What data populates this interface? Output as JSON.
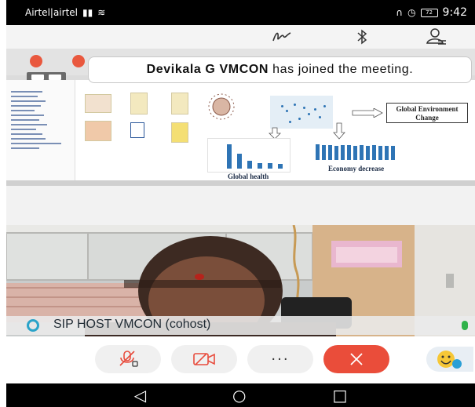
{
  "status_bar": {
    "carrier": "Airtel|airtel",
    "time": "9:42",
    "battery": "72"
  },
  "toolbar": {
    "pen_icon": "pen-scribble-icon",
    "bluetooth_icon": "bluetooth-icon",
    "participants_icon": "participants-icon"
  },
  "notification": {
    "name": "Devikala G VMCON",
    "message": " has joined the meeting."
  },
  "shared_slide": {
    "box_text": "Global Environment Change",
    "caption_health": "Global health",
    "caption_economy": "Economy decrease",
    "health_bars": [
      0.9,
      0.55,
      0.3,
      0.22,
      0.2,
      0.18
    ],
    "economy_bars": [
      0.9,
      0.85,
      0.88,
      0.84,
      0.86,
      0.85,
      0.83,
      0.86,
      0.84,
      0.85,
      0.82,
      0.83,
      0.84
    ]
  },
  "participant": {
    "name": "SIP HOST VMCON (cohost)"
  },
  "controls": {
    "mute_icon": "mic-muted-icon",
    "video_icon": "video-off-icon",
    "more_label": "···",
    "end_icon": "close-icon",
    "emoji_icon": "emoji-icon"
  },
  "nav": {
    "back": "◁",
    "home": "○",
    "recents": "□"
  },
  "colors": {
    "end_call": "#ea4d3a",
    "bar_blue": "#2e74b5",
    "mic_active": "#2fb24a",
    "avatar_ring": "#2aa3c9"
  }
}
